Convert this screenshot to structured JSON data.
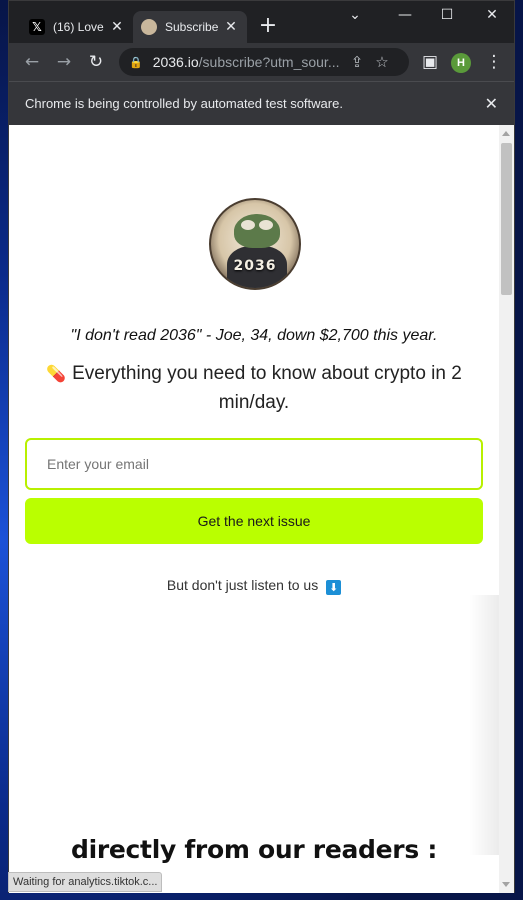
{
  "tabs": [
    {
      "label": "(16) Love",
      "favicon": "x-logo-icon",
      "active": false
    },
    {
      "label": "Subscribe",
      "favicon": "frog-favicon-icon",
      "active": true
    }
  ],
  "window_controls": {
    "minimize": "—",
    "maximize": "☐",
    "close": "✕",
    "tab_search": "⌄"
  },
  "toolbar": {
    "url_host": "2036.io",
    "url_path": "/subscribe?utm_sour...",
    "avatar_initial": "H"
  },
  "infobar": {
    "message": "Chrome is being controlled by automated test software."
  },
  "page": {
    "logo_text": "2036",
    "quote": "\"I don't read 2036\" - Joe, 34, down $2,700 this year.",
    "tagline_icon": "pill-emoji",
    "tagline": "Everything you need to know about crypto in 2 min/day.",
    "email_placeholder": "Enter your email",
    "email_value": "",
    "submit_label": "Get the next issue",
    "listen_text": "But don't just listen to us",
    "listen_icon": "down-arrow-emoji",
    "readers_heading": "directly from our readers :"
  },
  "status": {
    "text": "Waiting for analytics.tiktok.c..."
  },
  "colors": {
    "accent": "#baff00",
    "input_border": "#b8f000",
    "chrome_dark": "#202124",
    "chrome_mid": "#35363a"
  }
}
